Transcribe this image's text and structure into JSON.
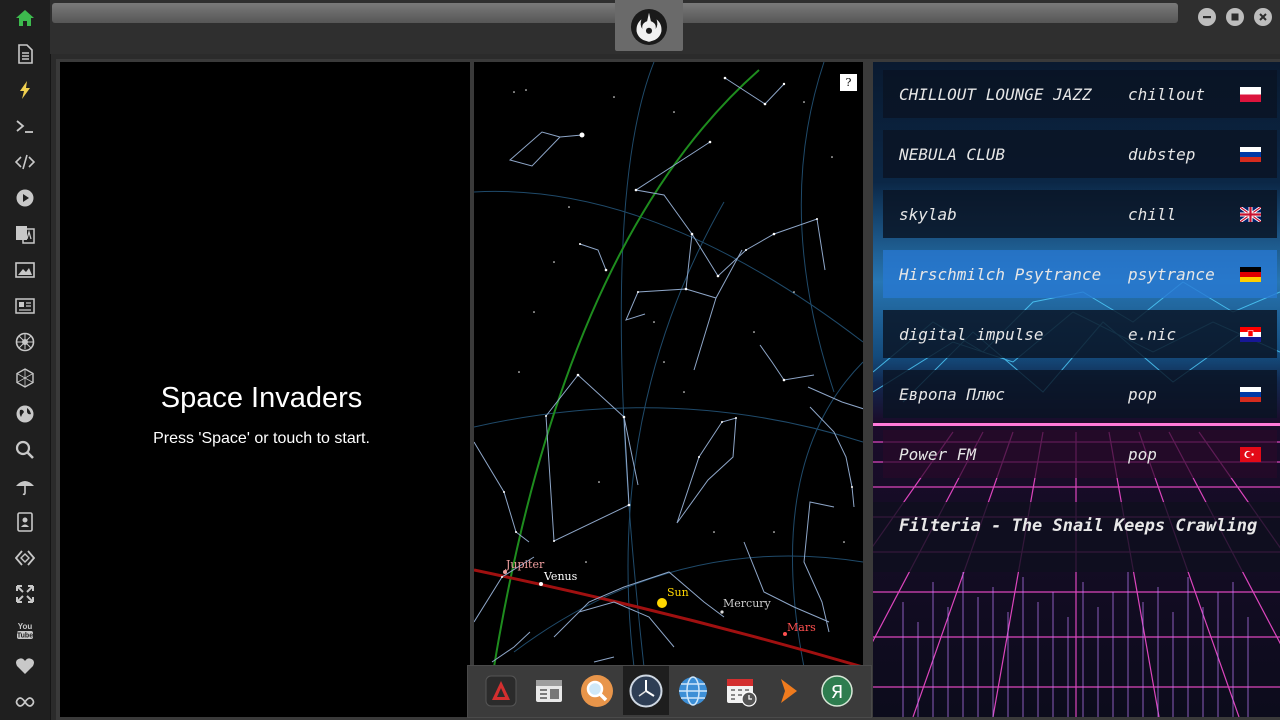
{
  "sidebar": {
    "items": [
      {
        "icon": "home-icon",
        "color": "#3dba4e"
      },
      {
        "icon": "document-icon"
      },
      {
        "icon": "lightning-icon",
        "color": "#f0d050"
      },
      {
        "icon": "terminal-icon"
      },
      {
        "icon": "code-icon"
      },
      {
        "icon": "play-icon"
      },
      {
        "icon": "translate-icon"
      },
      {
        "icon": "image-icon"
      },
      {
        "icon": "newspaper-icon"
      },
      {
        "icon": "empire-icon"
      },
      {
        "icon": "hexagon-icon"
      },
      {
        "icon": "globe-icon"
      },
      {
        "icon": "search-icon"
      },
      {
        "icon": "umbrella-icon"
      },
      {
        "icon": "contacts-icon"
      },
      {
        "icon": "embed-icon"
      },
      {
        "icon": "expand-icon"
      },
      {
        "icon": "youtube-icon"
      },
      {
        "icon": "heart-icon"
      },
      {
        "icon": "infinity-icon"
      }
    ]
  },
  "topbar": {
    "logo": "rebel-alliance-icon",
    "window_buttons": [
      "minimize-icon",
      "maximize-icon",
      "close-icon"
    ]
  },
  "game": {
    "title": "Space Invaders",
    "hint": "Press 'Space' or touch to start."
  },
  "skymap": {
    "help_label": "?",
    "bodies": {
      "jupiter": "Jupiter",
      "venus": "Venus",
      "sun": "Sun",
      "mercury": "Mercury",
      "mars": "Mars"
    },
    "colors": {
      "ecliptic": "#a01010",
      "equator": "#1e8c1e",
      "constellation": "#8ea6c8",
      "sun": "#ffd700"
    }
  },
  "radio": {
    "stations": [
      {
        "name": "CHILLOUT LOUNGE JAZZ",
        "genre": "chillout",
        "flag": "poland"
      },
      {
        "name": "NEBULA CLUB",
        "genre": "dubstep",
        "flag": "russia"
      },
      {
        "name": "skylab",
        "genre": "chill",
        "flag": "uk"
      },
      {
        "name": "Hirschmilch Psytrance",
        "genre": "psytrance",
        "flag": "germany"
      },
      {
        "name": "digital impulse",
        "genre": "e.nic",
        "flag": "croatia"
      },
      {
        "name": "Европа Плюс",
        "genre": "pop",
        "flag": "russia"
      },
      {
        "name": "Power FM",
        "genre": "pop",
        "flag": "turkey"
      }
    ],
    "now_playing": "Filteria - The Snail Keeps Crawling"
  },
  "dock": {
    "items": [
      "adobe-reader-icon",
      "calendar-widget-icon",
      "search-app-icon",
      "clock-icon",
      "globe-browser-icon",
      "calendar-clock-icon",
      "terminal-arrow-icon",
      "yandex-icon"
    ]
  }
}
